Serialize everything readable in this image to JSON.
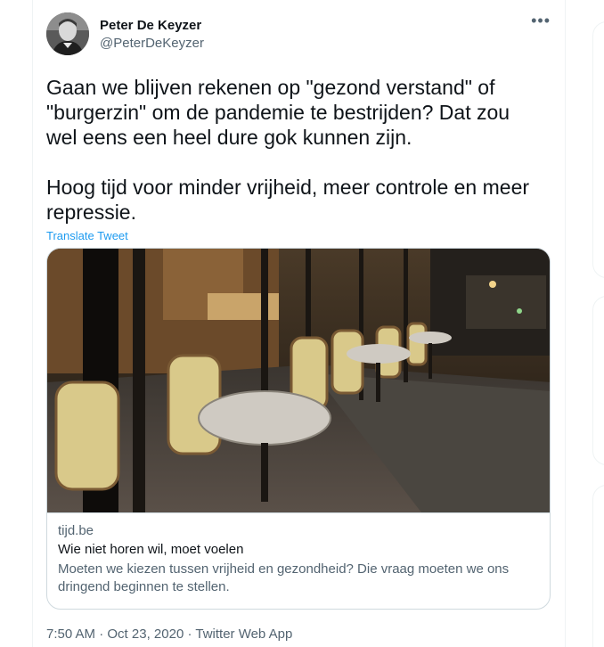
{
  "author": {
    "display_name": "Peter De Keyzer",
    "handle": "@PeterDeKeyzer"
  },
  "tweet": {
    "paragraphs": [
      "Gaan we blijven rekenen op \"gezond verstand\" of \"burgerzin\" om de pandemie te bestrijden? Dat zou wel eens een heel dure gok kunnen zijn.",
      "Hoog tijd voor minder vrijheid, meer controle en meer repressie."
    ],
    "translate_label": "Translate Tweet",
    "more_label": "•••"
  },
  "card": {
    "domain": "tijd.be",
    "title": "Wie niet horen wil, moet voelen",
    "description": "Moeten we kiezen tussen vrijheid en gezondheid? Die vraag moeten we ons dringend beginnen te stellen."
  },
  "meta": {
    "time": "7:50 AM",
    "date": "Oct 23, 2020",
    "source": "Twitter Web App",
    "separator": " · "
  },
  "colors": {
    "link": "#1d9bf0",
    "secondary_text": "#536471",
    "primary_text": "#0f1419",
    "border": "#cfd9de"
  },
  "icons": [
    "more-icon"
  ]
}
